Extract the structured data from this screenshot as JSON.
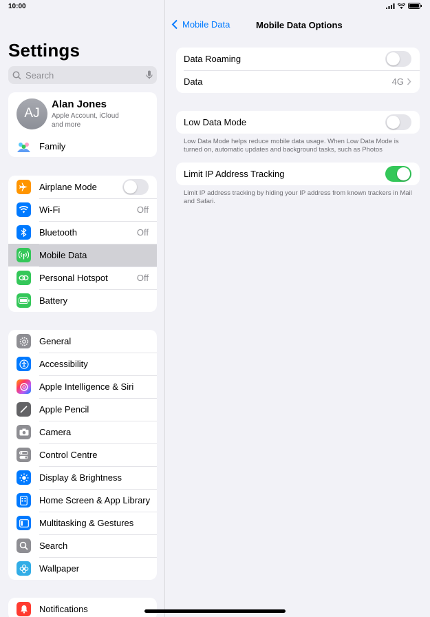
{
  "status": {
    "time": "10:00"
  },
  "sidebar": {
    "title": "Settings",
    "search": {
      "placeholder": "Search"
    },
    "profile": {
      "initials": "AJ",
      "name": "Alan Jones",
      "subtitle_line1": "Apple Account, iCloud",
      "subtitle_line2": "and more",
      "family_label": "Family"
    },
    "group1": [
      {
        "label": "Airplane Mode",
        "icon": "airplane-icon",
        "color": "#ff9500",
        "toggle": false
      },
      {
        "label": "Wi-Fi",
        "icon": "wifi-icon",
        "color": "#007aff",
        "value": "Off"
      },
      {
        "label": "Bluetooth",
        "icon": "bluetooth-icon",
        "color": "#007aff",
        "value": "Off"
      },
      {
        "label": "Mobile Data",
        "icon": "antenna-icon",
        "color": "#34c759",
        "selected": true
      },
      {
        "label": "Personal Hotspot",
        "icon": "hotspot-icon",
        "color": "#34c759",
        "value": "Off"
      },
      {
        "label": "Battery",
        "icon": "battery-icon",
        "color": "#34c759"
      }
    ],
    "group2": [
      {
        "label": "General",
        "icon": "gear-icon",
        "color": "#8e8e93"
      },
      {
        "label": "Accessibility",
        "icon": "accessibility-icon",
        "color": "#007aff"
      },
      {
        "label": "Apple Intelligence & Siri",
        "icon": "siri-icon",
        "color": "#ff6b8a"
      },
      {
        "label": "Apple Pencil",
        "icon": "pencil-icon",
        "color": "#636366"
      },
      {
        "label": "Camera",
        "icon": "camera-icon",
        "color": "#8e8e93"
      },
      {
        "label": "Control Centre",
        "icon": "control-centre-icon",
        "color": "#8e8e93"
      },
      {
        "label": "Display & Brightness",
        "icon": "brightness-icon",
        "color": "#007aff"
      },
      {
        "label": "Home Screen & App Library",
        "icon": "home-screen-icon",
        "color": "#007aff"
      },
      {
        "label": "Multitasking & Gestures",
        "icon": "multitasking-icon",
        "color": "#007aff"
      },
      {
        "label": "Search",
        "icon": "search-icon",
        "color": "#8e8e93"
      },
      {
        "label": "Wallpaper",
        "icon": "wallpaper-icon",
        "color": "#32ade6"
      }
    ],
    "group3": [
      {
        "label": "Notifications",
        "icon": "bell-icon",
        "color": "#ff3b30"
      }
    ]
  },
  "detail": {
    "back_label": "Mobile Data",
    "title": "Mobile Data Options",
    "data_roaming": {
      "label": "Data Roaming",
      "on": false
    },
    "data": {
      "label": "Data",
      "value": "4G"
    },
    "low_data_mode": {
      "label": "Low Data Mode",
      "on": false,
      "footer": "Low Data Mode helps reduce mobile data usage. When Low Data Mode is turned on, automatic updates and background tasks, such as Photos"
    },
    "limit_ip": {
      "label": "Limit IP Address Tracking",
      "on": true,
      "footer": "Limit IP address tracking by hiding your IP address from known trackers in Mail and Safari."
    }
  },
  "colors": {
    "accent": "#007aff",
    "toggle_on": "#34c759",
    "selected_row": "#d1d1d6"
  }
}
